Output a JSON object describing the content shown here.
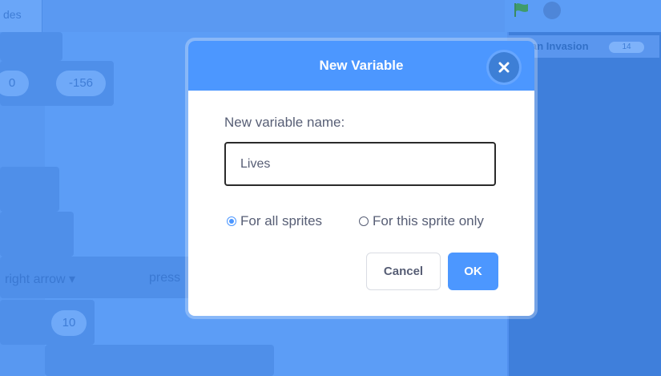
{
  "dialog": {
    "title": "New Variable",
    "field_label": "New variable name:",
    "input_value": "Lives",
    "scope_options": [
      {
        "label": "For all sprites",
        "selected": true
      },
      {
        "label": "For this sprite only",
        "selected": false
      }
    ],
    "cancel_label": "Cancel",
    "ok_label": "OK"
  },
  "background": {
    "tab_text": "des",
    "value_a": "0",
    "value_b": "-156",
    "dropdown_text": "right arrow ▾",
    "dropdown_text_2": "press",
    "value_c": "10",
    "stage_title": "an Invasion",
    "stage_badge": "14"
  },
  "colors": {
    "accent": "#4c97ff",
    "text": "#575e75",
    "overlay": "#5c9df6"
  },
  "icons": {
    "close": "close-icon",
    "flag": "green-flag-icon",
    "stop": "stop-icon"
  }
}
